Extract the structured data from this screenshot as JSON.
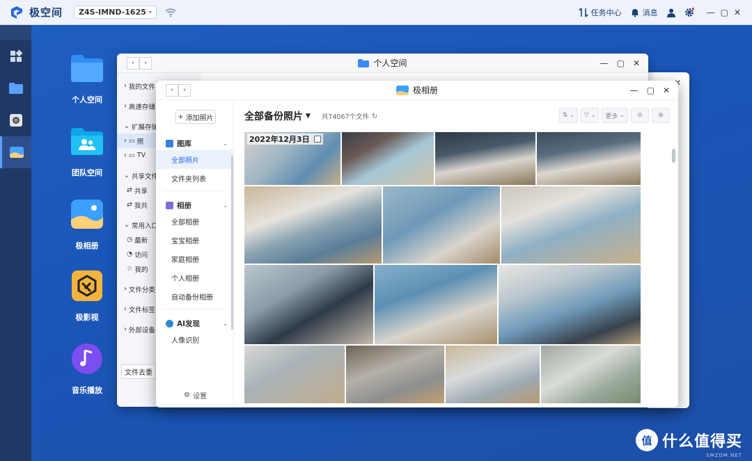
{
  "topbar": {
    "brand": "极空间",
    "device": "Z4S-IMND-1625",
    "tasks": "任务中心",
    "messages": "消息"
  },
  "desktop": [
    {
      "label": "个人空间",
      "icon": "folder-icon"
    },
    {
      "label": "团队空间",
      "icon": "team-folder-icon"
    },
    {
      "label": "极相册",
      "icon": "photo-album-icon"
    },
    {
      "label": "极影视",
      "icon": "video-icon"
    },
    {
      "label": "音乐播放",
      "icon": "music-icon"
    }
  ],
  "back_window": {
    "title": "个人空间",
    "sidebar": [
      "我的文件",
      "高速存储",
      "扩展存储",
      "照",
      "TV",
      "共享文件",
      "共享",
      "我共",
      "常用入口",
      "最新",
      "访问",
      "我的",
      "文件分类",
      "文件标签",
      "外部设备"
    ],
    "footer": "文件去重"
  },
  "photo_window": {
    "title": "极相册",
    "add_button": "添加照片",
    "sections": [
      {
        "label": "图库",
        "items": [
          "全部照片",
          "文件夹列表"
        ],
        "color": "#3b7de0"
      },
      {
        "label": "相册",
        "items": [
          "全部相册",
          "宝宝相册",
          "家庭相册",
          "个人相册",
          "自动备份相册"
        ],
        "color": "#7a6fd8"
      },
      {
        "label": "AI发现",
        "items": [
          "人像识别"
        ],
        "color": "#2a8ad8"
      }
    ],
    "selected_item": "全部照片",
    "settings": "设置",
    "album_title": "全部备份照片",
    "count_text": "共74067个文件",
    "more_label": "更多",
    "date_label": "2022年12月3日"
  },
  "watermark": {
    "circle": "值",
    "text": "什么值得买",
    "sub": "SMZDM.NET"
  }
}
